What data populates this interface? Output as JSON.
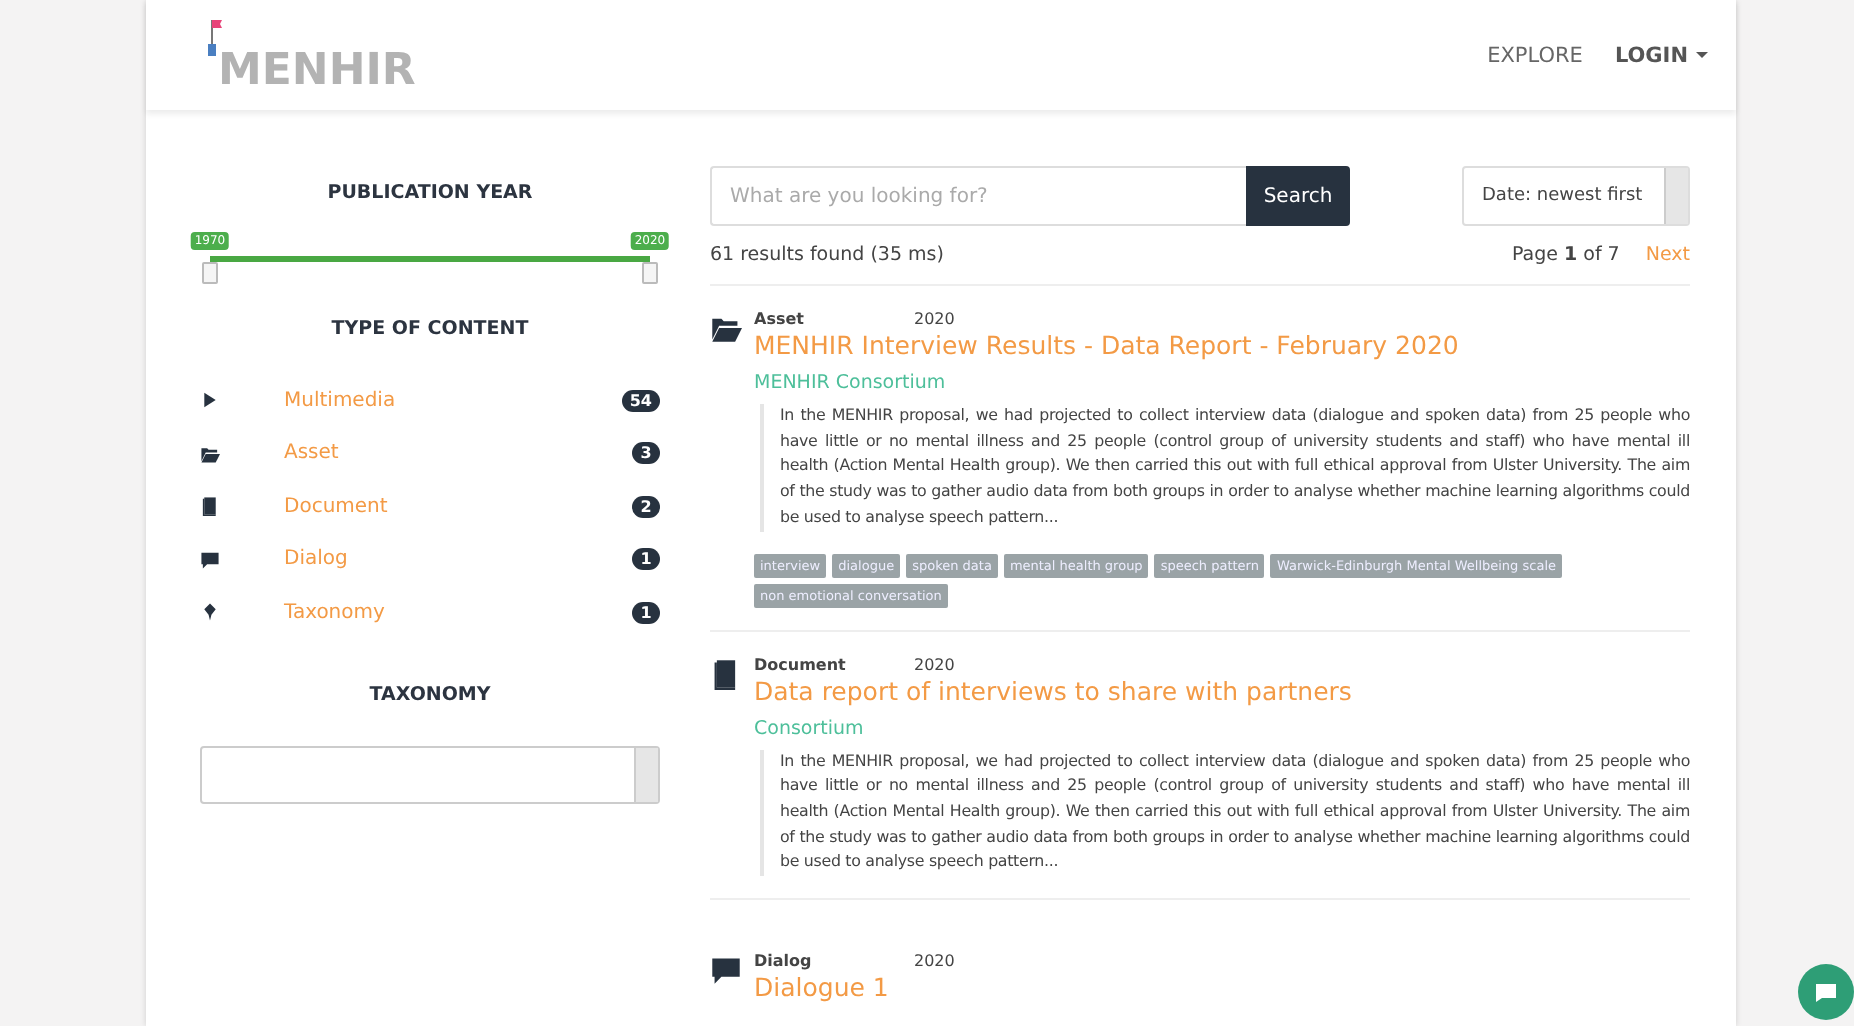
{
  "header": {
    "logo": "MENHIR",
    "nav": [
      {
        "label": "EXPLORE",
        "kind": "link"
      },
      {
        "label": "LOGIN",
        "kind": "dropdown"
      }
    ]
  },
  "filters": {
    "year": {
      "title": "PUBLICATION YEAR",
      "handles": [
        {
          "label": "1970",
          "level": 0
        },
        {
          "label": "2020",
          "level": 1
        }
      ]
    },
    "content": {
      "title": "TYPE OF CONTENT",
      "items": [
        {
          "label": "Multimedia",
          "count": "54",
          "kind": "play"
        },
        {
          "label": "Asset",
          "count": "3",
          "kind": "folder"
        },
        {
          "label": "Document",
          "count": "2",
          "kind": "book"
        },
        {
          "label": "Dialog",
          "count": "1",
          "kind": "comment"
        },
        {
          "label": "Taxonomy",
          "count": "1",
          "kind": "pin"
        }
      ]
    },
    "taxonomy": {
      "title": "TAXONOMY"
    }
  },
  "search": {
    "placeholder": "What are you looking for?",
    "button": "Search",
    "sort": "Date: newest first"
  },
  "summary": {
    "found": "61 results found (35 ms)",
    "page_before": "Page ",
    "page": "1",
    "page_after": " of 7",
    "next": "Next"
  },
  "results": [
    {
      "kind": "folder",
      "type": "Asset",
      "year": "2020",
      "title": "MENHIR Interview Results - Data Report - February 2020",
      "author": "MENHIR Consortium",
      "abstract": "In the MENHIR proposal, we had projected to collect interview data (dialogue and spoken data) from 25 people who have little or no mental illness and 25 people (control group of university students and staff) who have mental ill health (Action Mental Health group). We then carried this out with full ethical approval from Ulster University. The aim of the study was to gather audio data from both groups in order to analyse whether machine learning algorithms could be used to analyse speech pattern...",
      "tags": [
        "interview",
        "dialogue",
        "spoken data",
        "mental health group",
        "speech pattern",
        "Warwick-Edinburgh Mental Wellbeing scale",
        "non emotional conversation"
      ]
    },
    {
      "kind": "book",
      "type": "Document",
      "year": "2020",
      "title": "Data report of interviews to share with partners",
      "author": "Consortium",
      "abstract": "In the MENHIR proposal, we had projected to collect interview data (dialogue and spoken data) from 25 people who have little or no mental illness and 25 people (control group of university students and staff) who have mental ill health (Action Mental Health group). We then carried this out with full ethical approval from Ulster University. The aim of the study was to gather audio data from both groups in order to analyse whether machine learning algorithms could be used to analyse speech pattern..."
    },
    {
      "kind": "comment",
      "type": "Dialog",
      "year": "2020",
      "title": "Dialogue 1"
    }
  ]
}
